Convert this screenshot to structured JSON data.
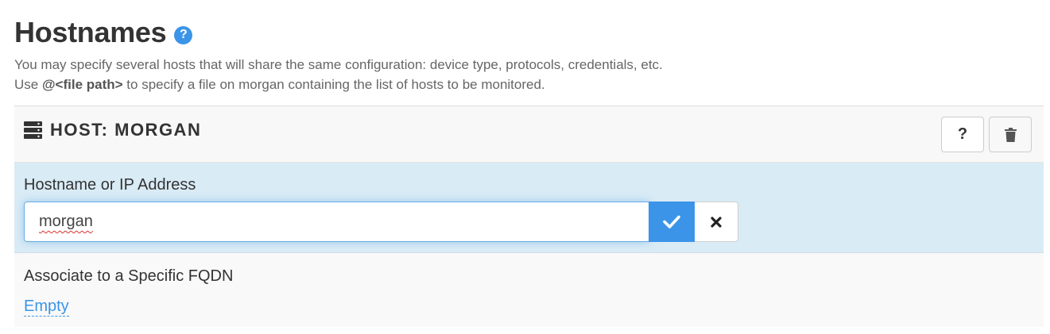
{
  "section": {
    "title": "Hostnames",
    "help_badge": "?",
    "description_line1": "You may specify several hosts that will share the same configuration: device type, protocols, credentials, etc.",
    "description_line2_prefix": "Use ",
    "description_line2_bold": "@<file path>",
    "description_line2_suffix": " to specify a file on morgan containing the list of hosts to be monitored."
  },
  "host_panel": {
    "title": "HOST: MORGAN",
    "icon": "server-icon",
    "help_button_label": "?",
    "delete_button_icon": "trash-icon"
  },
  "hostname_field": {
    "label": "Hostname or IP Address",
    "value": "morgan",
    "confirm_icon": "check-icon",
    "cancel_icon": "close-icon"
  },
  "fqdn_field": {
    "label": "Associate to a Specific FQDN",
    "value": "Empty"
  },
  "colors": {
    "accent": "#3b94e8",
    "edit_row_bg": "#d9ebf5",
    "panel_bg": "#f9f9f9"
  }
}
